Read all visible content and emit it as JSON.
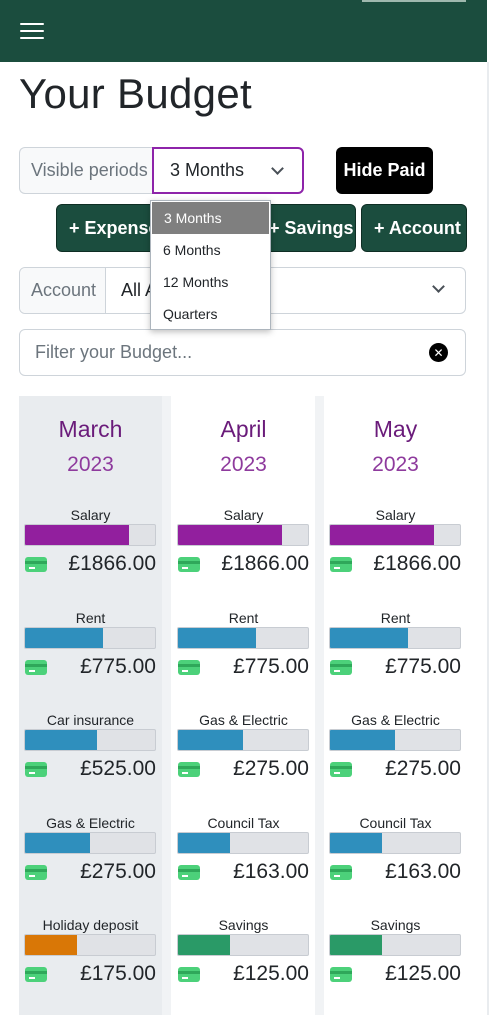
{
  "page_title": "Your Budget",
  "controls": {
    "visible_periods_label": "Visible periods",
    "visible_periods_value": "3 Months",
    "hide_paid_label": "Hide Paid",
    "add_expense_label": "+ Expense",
    "add_savings_label": "+ Savings",
    "add_account_label": "+ Account",
    "account_label": "Account",
    "account_value": "All A",
    "filter_placeholder": "Filter your Budget...",
    "clear_symbol": "✕"
  },
  "dropdown": {
    "options": [
      "3 Months",
      "6 Months",
      "12 Months",
      "Quarters"
    ],
    "selected": "3 Months"
  },
  "colors": {
    "header": "#1b4d3e",
    "income": "#921f9e",
    "bill": "#2f8fbd",
    "savings": "#2a9a67",
    "holiday": "#d97706",
    "paid_icon": "#4cd17a"
  },
  "months": [
    {
      "month": "March",
      "year": "2023",
      "items": [
        {
          "name": "Salary",
          "amount": "£1866.00",
          "progress": 0.8,
          "kind": "income"
        },
        {
          "name": "Rent",
          "amount": "£775.00",
          "progress": 0.6,
          "kind": "bill"
        },
        {
          "name": "Car insurance",
          "amount": "£525.00",
          "progress": 0.55,
          "kind": "bill"
        },
        {
          "name": "Gas & Electric",
          "amount": "£275.00",
          "progress": 0.5,
          "kind": "bill"
        },
        {
          "name": "Holiday deposit",
          "amount": "£175.00",
          "progress": 0.4,
          "kind": "holiday"
        }
      ]
    },
    {
      "month": "April",
      "year": "2023",
      "items": [
        {
          "name": "Salary",
          "amount": "£1866.00",
          "progress": 0.8,
          "kind": "income"
        },
        {
          "name": "Rent",
          "amount": "£775.00",
          "progress": 0.6,
          "kind": "bill"
        },
        {
          "name": "Gas & Electric",
          "amount": "£275.00",
          "progress": 0.5,
          "kind": "bill"
        },
        {
          "name": "Council Tax",
          "amount": "£163.00",
          "progress": 0.4,
          "kind": "bill"
        },
        {
          "name": "Savings",
          "amount": "£125.00",
          "progress": 0.4,
          "kind": "savings"
        }
      ]
    },
    {
      "month": "May",
      "year": "2023",
      "items": [
        {
          "name": "Salary",
          "amount": "£1866.00",
          "progress": 0.8,
          "kind": "income"
        },
        {
          "name": "Rent",
          "amount": "£775.00",
          "progress": 0.6,
          "kind": "bill"
        },
        {
          "name": "Gas & Electric",
          "amount": "£275.00",
          "progress": 0.5,
          "kind": "bill"
        },
        {
          "name": "Council Tax",
          "amount": "£163.00",
          "progress": 0.4,
          "kind": "bill"
        },
        {
          "name": "Savings",
          "amount": "£125.00",
          "progress": 0.4,
          "kind": "savings"
        }
      ]
    }
  ]
}
